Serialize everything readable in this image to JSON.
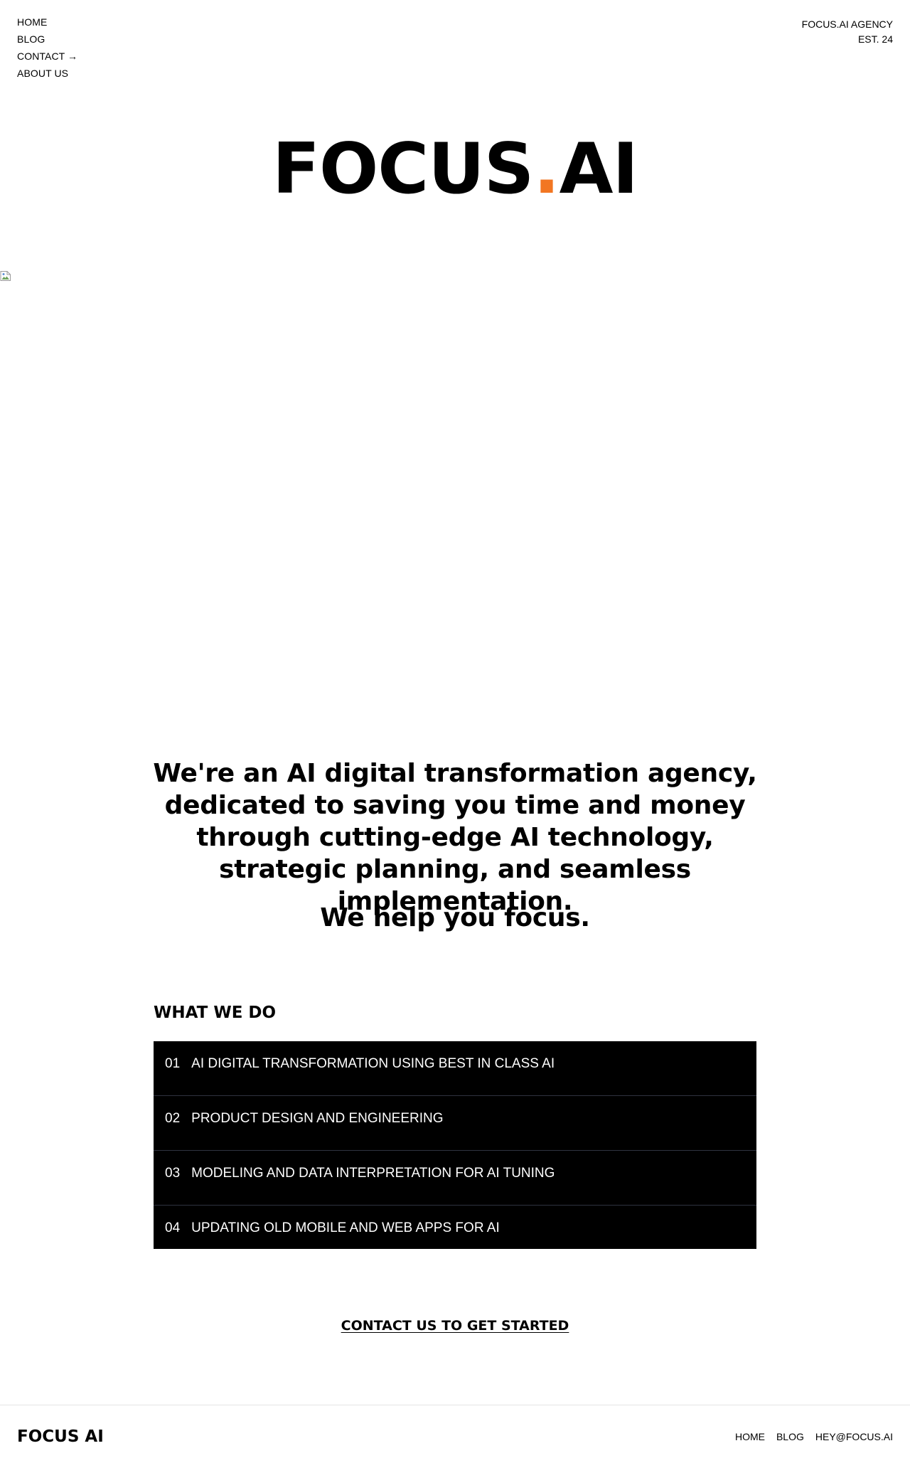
{
  "nav": {
    "items": [
      {
        "label": "HOME"
      },
      {
        "label": "BLOG"
      },
      {
        "label": "CONTACT →"
      },
      {
        "label": "ABOUT US"
      }
    ]
  },
  "agency": {
    "name": "FOCUS.AI AGENCY",
    "established": "EST. 24"
  },
  "hero": {
    "logo_left": "FOCUS",
    "logo_dot": ".",
    "logo_right": "AI",
    "image_icon": "broken-image-icon"
  },
  "mission": {
    "statement": "We're an AI digital transformation agency, dedicated to saving you time and money through cutting-edge AI technology, strategic planning, and seamless implementation.",
    "tagline": "We help you focus."
  },
  "services": {
    "heading": "WHAT WE DO",
    "items": [
      {
        "number": "01",
        "label": "AI DIGITAL TRANSFORMATION USING BEST IN CLASS AI"
      },
      {
        "number": "02",
        "label": "PRODUCT DESIGN AND ENGINEERING"
      },
      {
        "number": "03",
        "label": "MODELING AND DATA INTERPRETATION FOR AI TUNING"
      },
      {
        "number": "04",
        "label": "UPDATING OLD MOBILE AND WEB APPS FOR AI"
      }
    ]
  },
  "cta": {
    "label": "CONTACT US TO GET STARTED"
  },
  "footer": {
    "brand": "FOCUS AI",
    "links": [
      {
        "label": "HOME"
      },
      {
        "label": "BLOG"
      },
      {
        "label": "HEY@FOCUS.AI"
      }
    ]
  },
  "colors": {
    "accent": "#f27622",
    "services_bg": "#000000",
    "services_divider": "#2f3340"
  }
}
